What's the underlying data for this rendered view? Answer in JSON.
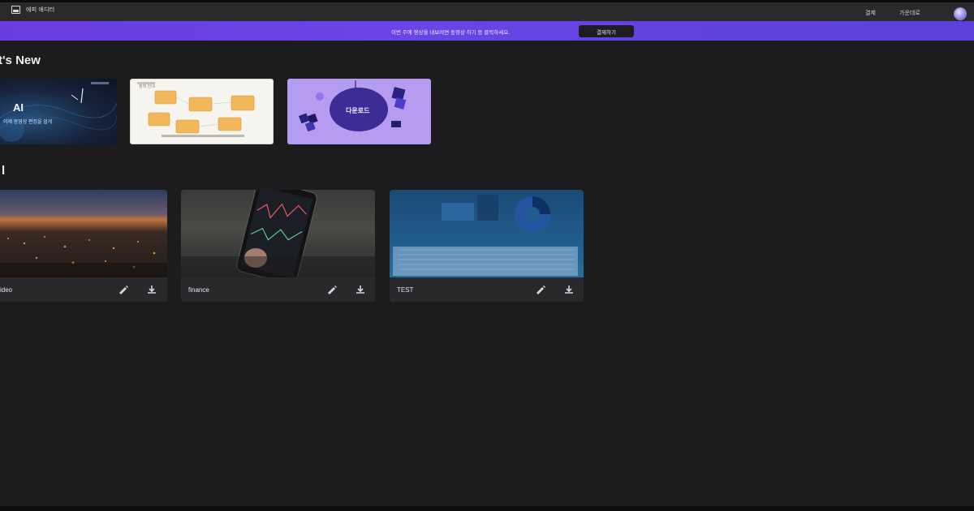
{
  "topbar": {
    "brand_name": "에피 에디터",
    "nav": [
      "결제",
      "가운데로"
    ]
  },
  "banner": {
    "text": "이번 주에 영상을 내보려면 동영상 하기 등 클릭하세요.",
    "button_label": "결제하기"
  },
  "whats_new": {
    "title": "t's New",
    "promos": [
      {
        "title": "AI",
        "caption": "이제 동영상 편집을 쉽게"
      },
      {
        "caption": "정책 안내"
      },
      {
        "caption": "다운로드"
      }
    ]
  },
  "projects": {
    "title": "l",
    "items": [
      {
        "title": "video"
      },
      {
        "title": "finance"
      },
      {
        "title": "TEST"
      }
    ]
  },
  "colors": {
    "background": "#1c1b1d",
    "topbar": "#2a292c",
    "banner": "#6a44e6",
    "card": "#29282b"
  },
  "icons": {
    "brand": "image-icon",
    "edit": "pencil-icon",
    "download": "download-icon",
    "avatar": "avatar"
  }
}
